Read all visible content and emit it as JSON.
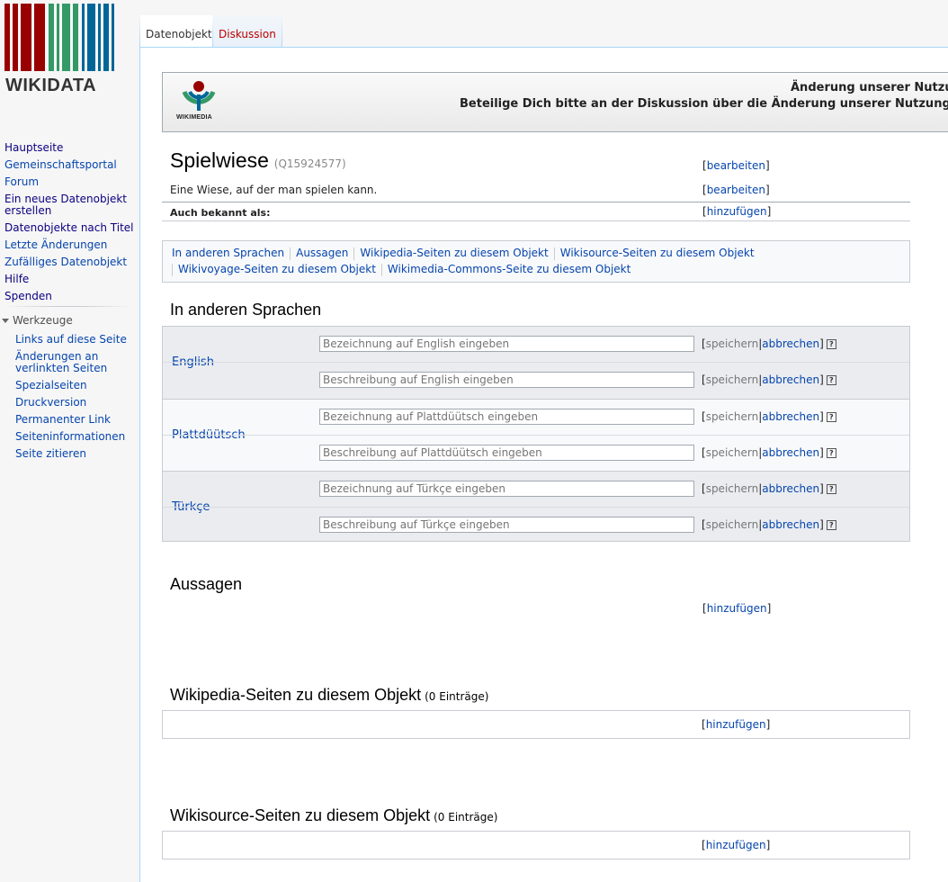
{
  "logo": {
    "text": "WIKIDATA"
  },
  "sidebar": {
    "main_items": [
      {
        "label": "Hauptseite"
      },
      {
        "label": "Gemeinschaftsportal"
      },
      {
        "label": "Forum"
      },
      {
        "label": "Ein neues Datenobjekt erstellen"
      },
      {
        "label": "Datenobjekte nach Titel"
      },
      {
        "label": "Letzte Änderungen"
      },
      {
        "label": "Zufälliges Datenobjekt"
      },
      {
        "label": "Hilfe"
      },
      {
        "label": "Spenden"
      }
    ],
    "tools_heading": "Werkzeuge",
    "tools_items": [
      {
        "label": "Links auf diese Seite"
      },
      {
        "label": "Änderungen an verlinkten Seiten"
      },
      {
        "label": "Spezialseiten"
      },
      {
        "label": "Druckversion"
      },
      {
        "label": "Permanenter Link"
      },
      {
        "label": "Seiteninformationen"
      },
      {
        "label": "Seite zitieren"
      }
    ]
  },
  "tabs": {
    "item": "Datenobjekt",
    "discussion": "Diskussion"
  },
  "notice": {
    "logo_text": "WIKIMEDIA",
    "line1": "Änderung unserer Nutzur",
    "line2": "Beteilige Dich bitte an der Diskussion über die Änderung unserer Nutzungsbe"
  },
  "item": {
    "label": "Spielwiese",
    "id": "(Q15924577)",
    "description": "Eine Wiese, auf der man spielen kann.",
    "aliases_label": "Auch bekannt als:"
  },
  "actions": {
    "edit": "bearbeiten",
    "add": "hinzufügen",
    "save": "speichern",
    "cancel": "abbrechen",
    "help": "?",
    "open_bracket": "[",
    "close_bracket": "]",
    "pipe": "|"
  },
  "toc": {
    "row1": [
      "In anderen Sprachen",
      "Aussagen",
      "Wikipedia-Seiten zu diesem Objekt",
      "Wikisource-Seiten zu diesem Objekt"
    ],
    "row2": [
      "Wikivoyage-Seiten zu diesem Objekt",
      "Wikimedia-Commons-Seite zu diesem Objekt"
    ]
  },
  "sections": {
    "languages": "In anderen Sprachen",
    "statements": "Aussagen",
    "wikipedia": "Wikipedia-Seiten zu diesem Objekt",
    "wikipedia_count": "(0 Einträge)",
    "wikisource": "Wikisource-Seiten zu diesem Objekt",
    "wikisource_count": "(0 Einträge)"
  },
  "languages": [
    {
      "name": "English",
      "label_placeholder": "Bezeichnung auf English eingeben",
      "desc_placeholder": "Beschreibung auf English eingeben"
    },
    {
      "name": "Plattdüütsch",
      "label_placeholder": "Bezeichnung auf Plattdüütsch eingeben",
      "desc_placeholder": "Beschreibung auf Plattdüütsch eingeben"
    },
    {
      "name": "Türkçe",
      "label_placeholder": "Bezeichnung auf Türkçe eingeben",
      "desc_placeholder": "Beschreibung auf Türkçe eingeben"
    }
  ]
}
